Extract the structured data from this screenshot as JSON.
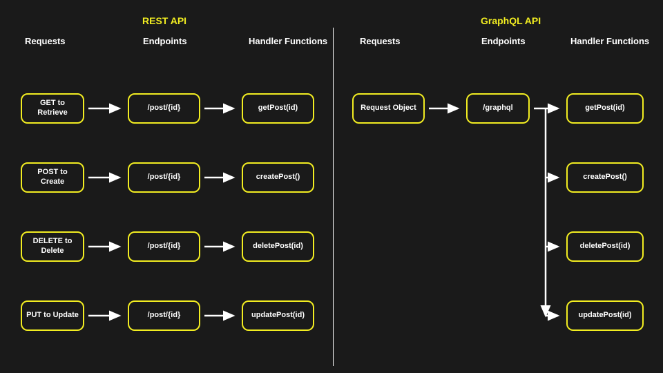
{
  "titles": {
    "rest": "REST API",
    "graphql": "GraphQL API"
  },
  "columns": {
    "requests": "Requests",
    "endpoints": "Endpoints",
    "handlers": "Handler Functions"
  },
  "rest": {
    "rows": [
      {
        "request": "GET to Retrieve",
        "endpoint": "/post/{id}",
        "handler": "getPost(id)"
      },
      {
        "request": "POST to Create",
        "endpoint": "/post/{id}",
        "handler": "createPost()"
      },
      {
        "request": "DELETE to Delete",
        "endpoint": "/post/{id}",
        "handler": "deletePost(id)"
      },
      {
        "request": "PUT to Update",
        "endpoint": "/post/{id}",
        "handler": "updatePost(id)"
      }
    ]
  },
  "graphql": {
    "request": "Request Object",
    "endpoint": "/graphql",
    "handlers": [
      "getPost(id)",
      "createPost()",
      "deletePost(id)",
      "updatePost(id)"
    ]
  },
  "colors": {
    "accent": "#f2ed21",
    "bg": "#1a1a1a",
    "fg": "#ffffff"
  }
}
